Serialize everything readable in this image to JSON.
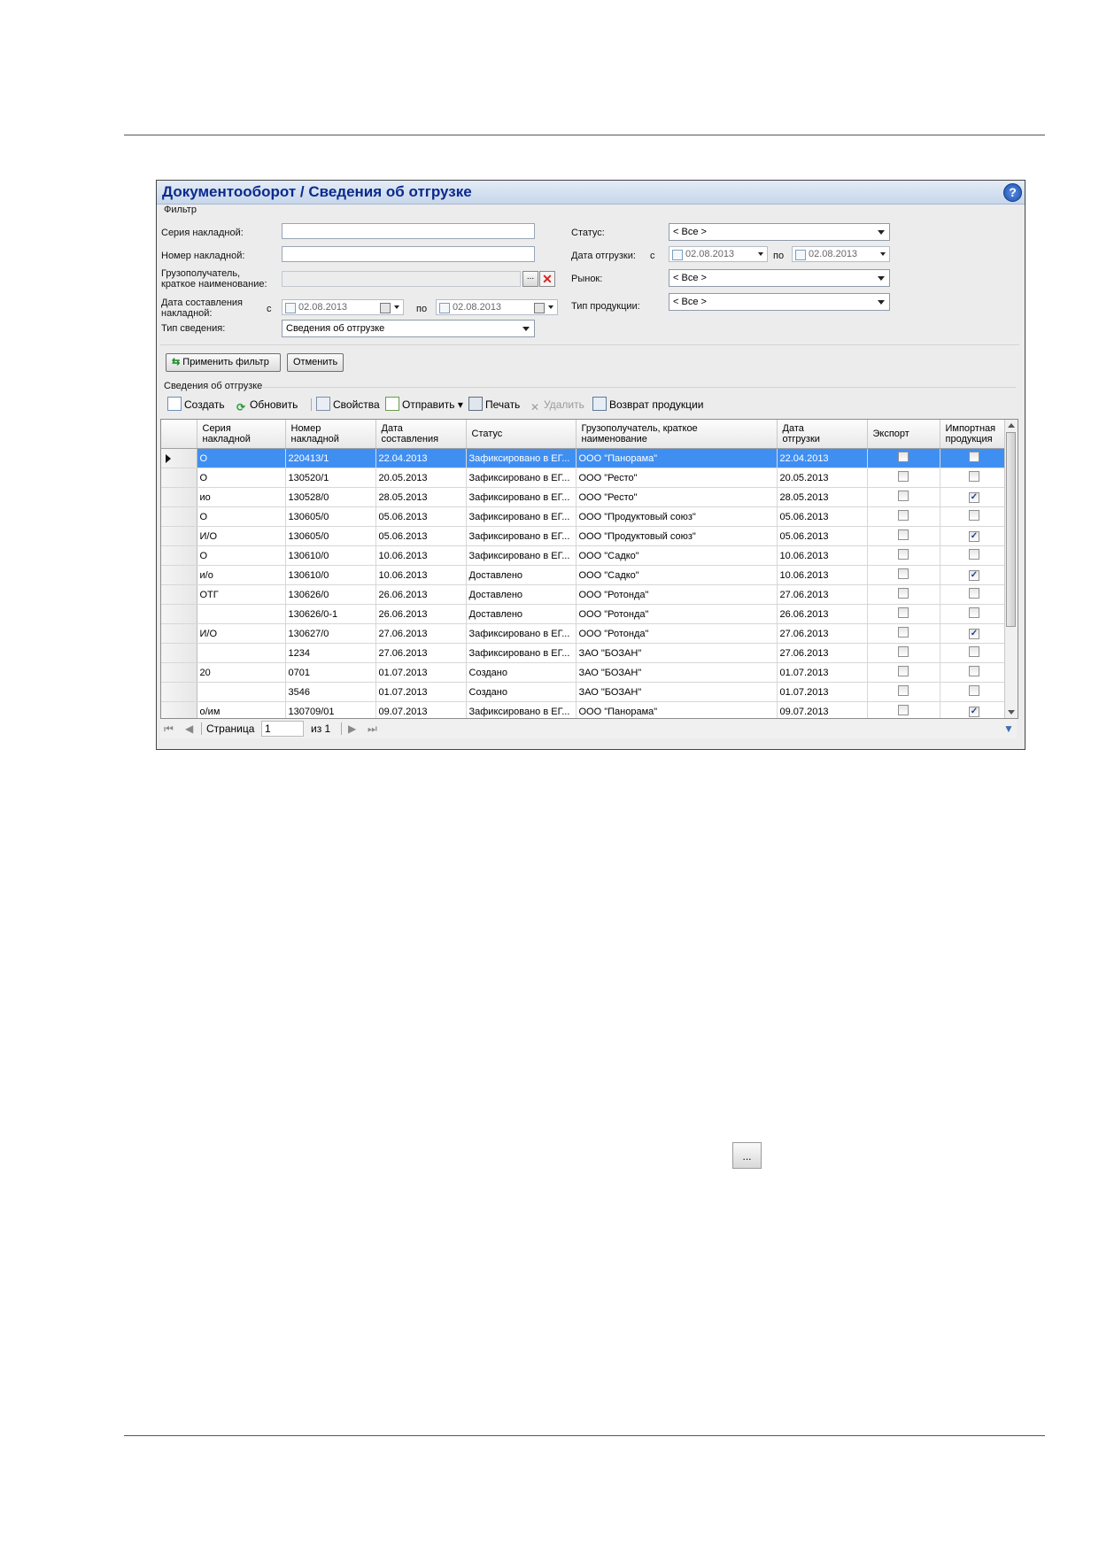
{
  "window": {
    "title": "Документооборот  / Сведения об отгрузке",
    "help_icon": "?"
  },
  "filter": {
    "group_label": "Фильтр",
    "series_label": "Серия накладной:",
    "number_label": "Номер накладной:",
    "consignee_label_1": "Грузополучатель,",
    "consignee_label_2": "краткое наименование:",
    "browse_button": "...",
    "doc_date_label_1": "Дата составления",
    "doc_date_label_2": "накладной:",
    "from": "с",
    "to": "по",
    "doc_date_from": "02.08.2013",
    "doc_date_to": "02.08.2013",
    "info_type_label": "Тип сведения:",
    "info_type_value": "Сведения об отгрузке",
    "status_label": "Статус:",
    "status_value": "< Все >",
    "ship_date_label": "Дата отгрузки:",
    "ship_date_from": "02.08.2013",
    "ship_date_to": "02.08.2013",
    "market_label": "Рынок:",
    "market_value": "< Все >",
    "product_type_label": "Тип продукции:",
    "product_type_value": "< Все >",
    "apply_button": "Применить фильтр",
    "cancel_button": "Отменить"
  },
  "section_label": "Сведения об отгрузке",
  "toolbar": {
    "create": "Создать",
    "refresh": "Обновить",
    "properties": "Свойства",
    "send": "Отправить",
    "print": "Печать",
    "delete": "Удалить",
    "return": "Возврат продукции"
  },
  "grid": {
    "columns": [
      [
        "Серия",
        "накладной"
      ],
      [
        "Номер",
        "накладной"
      ],
      [
        "Дата",
        "составления"
      ],
      [
        "Статус",
        ""
      ],
      [
        "Грузополучатель, краткое",
        "наименование"
      ],
      [
        "Дата",
        "отгрузки"
      ],
      [
        "Экспорт",
        ""
      ],
      [
        "Импортная",
        "продукция"
      ]
    ],
    "rows": [
      {
        "series": "О",
        "number": "220413/1",
        "date": "22.04.2013",
        "status": "Зафиксировано в ЕГ...",
        "consignee": "ООО \"Панорама\"",
        "ship": "22.04.2013",
        "export": false,
        "import": false,
        "selected": true
      },
      {
        "series": "О",
        "number": "130520/1",
        "date": "20.05.2013",
        "status": "Зафиксировано в ЕГ...",
        "consignee": "ООО \"Ресто\"",
        "ship": "20.05.2013",
        "export": false,
        "import": false
      },
      {
        "series": "ио",
        "number": "130528/0",
        "date": "28.05.2013",
        "status": "Зафиксировано в ЕГ...",
        "consignee": "ООО \"Ресто\"",
        "ship": "28.05.2013",
        "export": false,
        "import": true
      },
      {
        "series": "О",
        "number": "130605/0",
        "date": "05.06.2013",
        "status": "Зафиксировано в ЕГ...",
        "consignee": "ООО \"Продуктовый союз\"",
        "ship": "05.06.2013",
        "export": false,
        "import": false
      },
      {
        "series": "И/О",
        "number": "130605/0",
        "date": "05.06.2013",
        "status": "Зафиксировано в ЕГ...",
        "consignee": "ООО \"Продуктовый союз\"",
        "ship": "05.06.2013",
        "export": false,
        "import": true
      },
      {
        "series": "О",
        "number": "130610/0",
        "date": "10.06.2013",
        "status": "Зафиксировано в ЕГ...",
        "consignee": "ООО \"Садко\"",
        "ship": "10.06.2013",
        "export": false,
        "import": false
      },
      {
        "series": "и/о",
        "number": "130610/0",
        "date": "10.06.2013",
        "status": "Доставлено",
        "consignee": "ООО \"Садко\"",
        "ship": "10.06.2013",
        "export": false,
        "import": true
      },
      {
        "series": "ОТГ",
        "number": "130626/0",
        "date": "26.06.2013",
        "status": "Доставлено",
        "consignee": "ООО \"Ротонда\"",
        "ship": "27.06.2013",
        "export": false,
        "import": false
      },
      {
        "series": "",
        "number": "130626/0-1",
        "date": "26.06.2013",
        "status": "Доставлено",
        "consignee": "ООО \"Ротонда\"",
        "ship": "26.06.2013",
        "export": false,
        "import": false
      },
      {
        "series": "И/О",
        "number": "130627/0",
        "date": "27.06.2013",
        "status": "Зафиксировано в ЕГ...",
        "consignee": "ООО \"Ротонда\"",
        "ship": "27.06.2013",
        "export": false,
        "import": true
      },
      {
        "series": "",
        "number": "1234",
        "date": "27.06.2013",
        "status": "Зафиксировано в ЕГ...",
        "consignee": "ЗАО \"БОЗАН\"",
        "ship": "27.06.2013",
        "export": false,
        "import": false
      },
      {
        "series": "20",
        "number": "0701",
        "date": "01.07.2013",
        "status": "Создано",
        "consignee": "ЗАО \"БОЗАН\"",
        "ship": "01.07.2013",
        "export": false,
        "import": false
      },
      {
        "series": "",
        "number": "3546",
        "date": "01.07.2013",
        "status": "Создано",
        "consignee": "ЗАО \"БОЗАН\"",
        "ship": "01.07.2013",
        "export": false,
        "import": false
      },
      {
        "series": "о/им",
        "number": "130709/01",
        "date": "09.07.2013",
        "status": "Зафиксировано в ЕГ...",
        "consignee": "ООО \"Панорама\"",
        "ship": "09.07.2013",
        "export": false,
        "import": true
      }
    ]
  },
  "pager": {
    "page_label": "Страница",
    "page_value": "1",
    "of_label": "из 1"
  },
  "standalone_button": "...",
  "colors": {
    "title_text": "#0b2a8c",
    "selection": "#3f8ff2"
  }
}
